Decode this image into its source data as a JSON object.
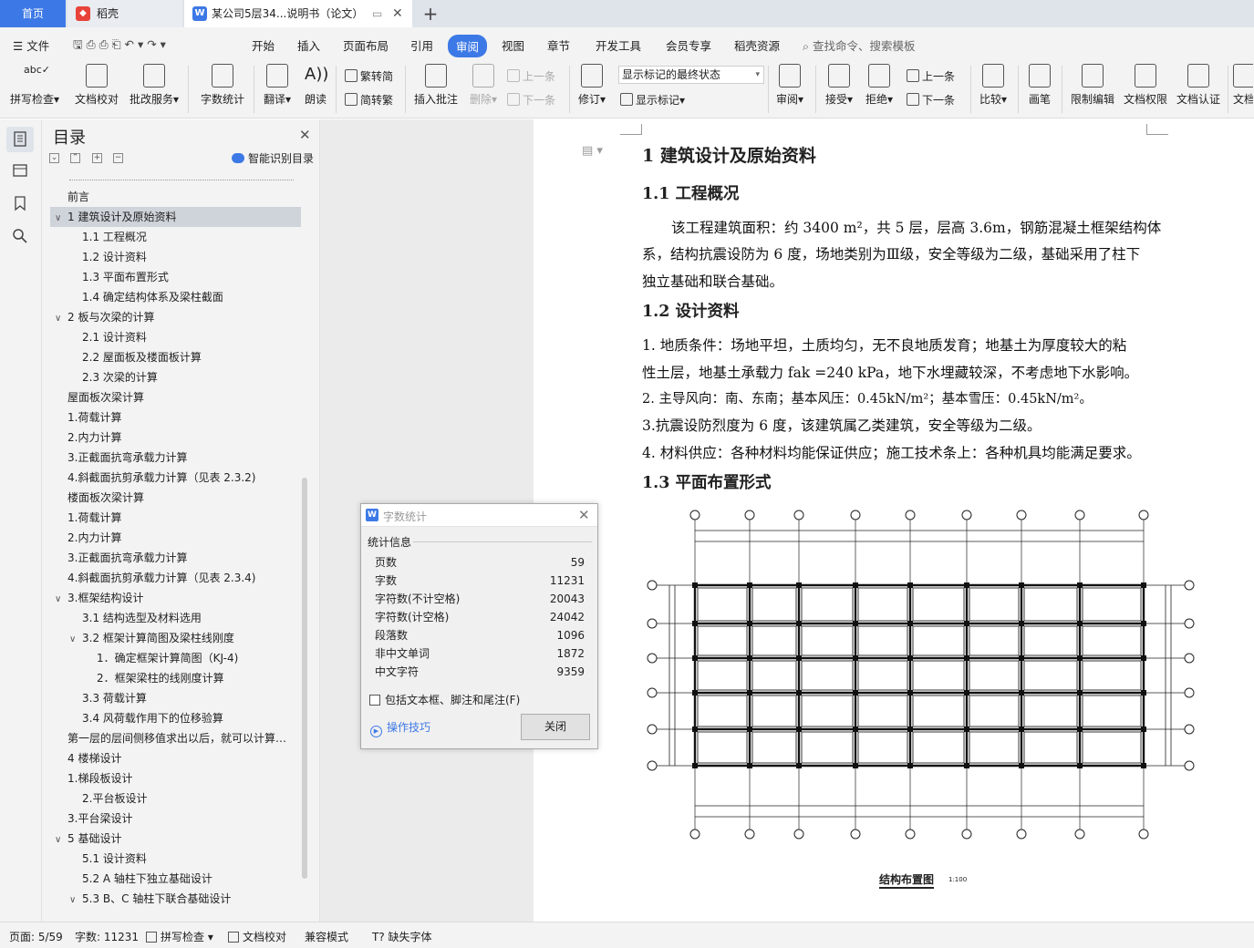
{
  "tabs": {
    "home": "首页",
    "docer": "稻壳",
    "document": "某公司5层34...说明书（论文）"
  },
  "menu": [
    "文件",
    "开始",
    "插入",
    "页面布局",
    "引用",
    "审阅",
    "视图",
    "章节",
    "开发工具",
    "会员专享",
    "稻壳资源"
  ],
  "search_placeholder": "查找命令、搜索模板",
  "ribbon": {
    "spell_check": "拼写检查",
    "doc_proof": "文档校对",
    "proof_service": "批改服务",
    "word_count": "字数统计",
    "translate": "翻译",
    "read_aloud": "朗读",
    "to_traditional": "繁转简",
    "to_simplified": "简转繁",
    "insert_comment": "插入批注",
    "delete": "删除",
    "prev": "上一条",
    "next": "下一条",
    "revise": "修订",
    "markup_select": "显示标记的最终状态",
    "show_markup": "显示标记",
    "review": "审阅",
    "accept": "接受",
    "reject": "拒绝",
    "prev2": "上一条",
    "next2": "下一条",
    "compare": "比较",
    "pen": "画笔",
    "restrict_edit": "限制编辑",
    "doc_permission": "文档权限",
    "doc_certify": "文档认证",
    "doc_more": "文档"
  },
  "toc": {
    "title": "目录",
    "smart": "智能识别目录",
    "items": [
      {
        "text": "前言",
        "level": 0
      },
      {
        "text": "1   建筑设计及原始资料",
        "level": 0,
        "caret": "∨",
        "selected": true
      },
      {
        "text": "1.1 工程概况",
        "level": 1
      },
      {
        "text": "1.2    设计资料",
        "level": 1
      },
      {
        "text": "1.3  平面布置形式",
        "level": 1
      },
      {
        "text": "1.4  确定结构体系及梁柱截面",
        "level": 1
      },
      {
        "text": "2  板与次梁的计算",
        "level": 0,
        "caret": "∨"
      },
      {
        "text": "2.1 设计资料",
        "level": 1
      },
      {
        "text": "2.2 屋面板及楼面板计算",
        "level": 1
      },
      {
        "text": "2.3 次梁的计算",
        "level": 1
      },
      {
        "text": "屋面板次梁计算",
        "level": 0
      },
      {
        "text": "1.荷载计算",
        "level": 0
      },
      {
        "text": "2.内力计算",
        "level": 0
      },
      {
        "text": "3.正截面抗弯承载力计算",
        "level": 0
      },
      {
        "text": "4.斜截面抗剪承载力计算（见表 2.3.2)",
        "level": 0
      },
      {
        "text": "楼面板次梁计算",
        "level": 0
      },
      {
        "text": "1.荷载计算",
        "level": 0
      },
      {
        "text": "2.内力计算",
        "level": 0
      },
      {
        "text": "3.正截面抗弯承载力计算",
        "level": 0
      },
      {
        "text": "4.斜截面抗剪承载力计算（见表 2.3.4)",
        "level": 0
      },
      {
        "text": "3.框架结构设计",
        "level": 0,
        "caret": "∨"
      },
      {
        "text": "3.1 结构选型及材料选用",
        "level": 1
      },
      {
        "text": "3.2 框架计算简图及梁柱线刚度",
        "level": 1,
        "caret": "∨"
      },
      {
        "text": "1．确定框架计算简图（KJ-4)",
        "level": 2
      },
      {
        "text": "2．框架梁柱的线刚度计算",
        "level": 2
      },
      {
        "text": "3.3 荷载计算",
        "level": 1
      },
      {
        "text": "3.4 风荷载作用下的位移验算",
        "level": 1
      },
      {
        "text": "第一层的层间侧移值求出以后，就可以计算…",
        "level": 0
      },
      {
        "text": "4 楼梯设计",
        "level": 0
      },
      {
        "text": "1.梯段板设计",
        "level": 0
      },
      {
        "text": "2.平台板设计",
        "level": 1
      },
      {
        "text": "3.平台梁设计",
        "level": 0
      },
      {
        "text": "5 基础设计",
        "level": 0,
        "caret": "∨"
      },
      {
        "text": "5.1 设计资料",
        "level": 1
      },
      {
        "text": "5.2 A 轴柱下独立基础设计",
        "level": 1
      },
      {
        "text": "5.3 B、C 轴柱下联合基础设计",
        "level": 1,
        "caret": "∨"
      }
    ]
  },
  "document": {
    "h1": "1    建筑设计及原始资料",
    "h11": "1.1 工程概况",
    "p1a": "该工程建筑面积：约 3400 m²，共 5 层，层高 3.6m，钢筋混凝土框架结构体",
    "p1b": "系，结构抗震设防为 6 度，场地类别为Ⅲ级，安全等级为二级，基础采用了柱下",
    "p1c": "独立基础和联合基础。",
    "h12": "1.2    设计资料",
    "p2a": "1. 地质条件：场地平坦，土质均匀，无不良地质发育；地基土为厚度较大的粘",
    "p2b": "性土层，地基土承载力 fak =240 kPa，地下水埋藏较深，不考虑地下水影响。",
    "p3": "2. 主导风向：南、东南；基本风压：0.45kN/m²；基本雪压：0.45kN/m²。",
    "p4": "3.抗震设防烈度为 6 度，该建筑属乙类建筑，安全等级为二级。",
    "p5": "4. 材料供应：各种材料均能保证供应；施工技术条上：各种机具均能满足要求。",
    "h13": "1.3  平面布置形式",
    "figure_caption": "结构布置图",
    "figure_scale": "1:100"
  },
  "dialog": {
    "title": "字数统计",
    "group": "统计信息",
    "rows": [
      {
        "label": "页数",
        "value": "59"
      },
      {
        "label": "字数",
        "value": "11231"
      },
      {
        "label": "字符数(不计空格)",
        "value": "20043"
      },
      {
        "label": "字符数(计空格)",
        "value": "24042"
      },
      {
        "label": "段落数",
        "value": "1096"
      },
      {
        "label": "非中文单词",
        "value": "1872"
      },
      {
        "label": "中文字符",
        "value": "9359"
      }
    ],
    "checkbox": "包括文本框、脚注和尾注(F)",
    "tips": "操作技巧",
    "close": "关闭"
  },
  "status": {
    "page": "页面: 5/59",
    "words": "字数: 11231",
    "spell": "拼写检查",
    "proof": "文档校对",
    "compat": "兼容模式",
    "missing_font": "缺失字体"
  },
  "colors": {
    "accent": "#3d79e6",
    "docer": "#e8433a"
  }
}
